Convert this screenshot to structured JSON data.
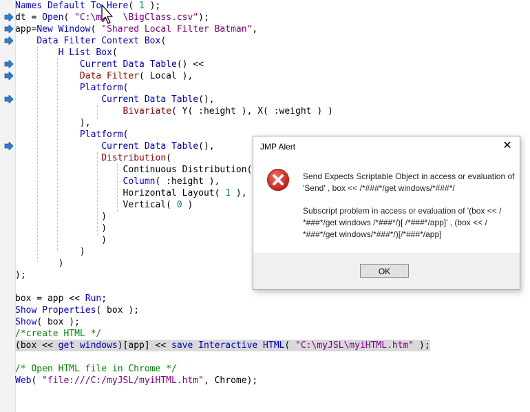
{
  "editor": {
    "lines": [
      [
        [
          "fn",
          "Names Default To Here"
        ],
        [
          "tx",
          "( "
        ],
        [
          "num",
          "1"
        ],
        [
          "tx",
          " );"
        ]
      ],
      [
        [
          "tx",
          "dt = "
        ],
        [
          "fn",
          "Open"
        ],
        [
          "tx",
          "( "
        ],
        [
          "str",
          "\"C:\\my   \\BigClass.csv\""
        ],
        [
          "tx",
          ");"
        ]
      ],
      [
        [
          "tx",
          "app="
        ],
        [
          "fn",
          "New Window"
        ],
        [
          "tx",
          "( "
        ],
        [
          "str",
          "\"Shared Local Filter Batman\""
        ],
        [
          "tx",
          ","
        ]
      ],
      [
        [
          "tx",
          "    "
        ],
        [
          "fn",
          "Data Filter Context Box"
        ],
        [
          "tx",
          "("
        ]
      ],
      [
        [
          "tx",
          "        "
        ],
        [
          "fn",
          "H List Box"
        ],
        [
          "tx",
          "("
        ]
      ],
      [
        [
          "tx",
          "            "
        ],
        [
          "fn",
          "Current Data Table"
        ],
        [
          "tx",
          "() <<"
        ]
      ],
      [
        [
          "tx",
          "            "
        ],
        [
          "bv",
          "Data Filter"
        ],
        [
          "tx",
          "( Local ),"
        ]
      ],
      [
        [
          "tx",
          "            "
        ],
        [
          "fn",
          "Platform"
        ],
        [
          "tx",
          "("
        ]
      ],
      [
        [
          "tx",
          "                "
        ],
        [
          "fn",
          "Current Data Table"
        ],
        [
          "tx",
          "(),"
        ]
      ],
      [
        [
          "tx",
          "                    "
        ],
        [
          "bv",
          "Bivariate"
        ],
        [
          "tx",
          "( Y( :height ), X( :weight ) )"
        ]
      ],
      [
        [
          "tx",
          "            ),"
        ]
      ],
      [
        [
          "tx",
          "            "
        ],
        [
          "fn",
          "Platform"
        ],
        [
          "tx",
          "("
        ]
      ],
      [
        [
          "tx",
          "                "
        ],
        [
          "fn",
          "Current Data Table"
        ],
        [
          "tx",
          "(),"
        ]
      ],
      [
        [
          "tx",
          "                "
        ],
        [
          "bv",
          "Distribution"
        ],
        [
          "tx",
          "("
        ]
      ],
      [
        [
          "tx",
          "                    "
        ],
        [
          "tx",
          "Continuous Distribution("
        ]
      ],
      [
        [
          "tx",
          "                    "
        ],
        [
          "fn",
          "Column"
        ],
        [
          "tx",
          "( :height ),"
        ]
      ],
      [
        [
          "tx",
          "                    "
        ],
        [
          "tx",
          "Horizontal Layout( "
        ],
        [
          "num",
          "1"
        ],
        [
          "tx",
          " ),"
        ]
      ],
      [
        [
          "tx",
          "                    "
        ],
        [
          "tx",
          "Vertical( "
        ],
        [
          "num",
          "0"
        ],
        [
          "tx",
          " )"
        ]
      ],
      [
        [
          "tx",
          "                )"
        ]
      ],
      [
        [
          "tx",
          "                )"
        ]
      ],
      [
        [
          "tx",
          "                )"
        ]
      ],
      [
        [
          "tx",
          "            )"
        ]
      ],
      [
        [
          "tx",
          "        )"
        ]
      ],
      [
        [
          "tx",
          ");"
        ]
      ],
      [
        [
          "tx",
          ""
        ]
      ],
      [
        [
          "tx",
          "box = app << "
        ],
        [
          "fn",
          "Run"
        ],
        [
          "tx",
          ";"
        ]
      ],
      [
        [
          "fn",
          "Show Properties"
        ],
        [
          "tx",
          "( box );"
        ]
      ],
      [
        [
          "fn",
          "Show"
        ],
        [
          "tx",
          "( box );"
        ]
      ],
      [
        [
          "cm",
          "/*create HTML */"
        ]
      ],
      [
        [
          "tx",
          "(box << "
        ],
        [
          "fn",
          "get windows"
        ],
        [
          "tx",
          ")[app] << "
        ],
        [
          "fn",
          "save Interactive HTML"
        ],
        [
          "tx",
          "( "
        ],
        [
          "str",
          "\"C:\\myJSL\\myiHTML.htm\""
        ],
        [
          "tx",
          " );"
        ]
      ],
      [
        [
          "tx",
          ""
        ]
      ],
      [
        [
          "cm",
          "/* Open HTML file in Chrome */"
        ]
      ],
      [
        [
          "fn",
          "Web"
        ],
        [
          "tx",
          "( "
        ],
        [
          "str",
          "\"file:///C:/myJSL/myiHTML.htm\""
        ],
        [
          "tx",
          ", Chrome);"
        ]
      ]
    ],
    "breakpoint_lines": [
      1,
      2,
      3,
      5,
      6,
      8,
      12
    ]
  },
  "dialog": {
    "title": "JMP Alert",
    "close_glyph": "✕",
    "message_line1": "Send Expects Scriptable Object in access or evaluation of",
    "message_line2": "'Send' , box <<  /*###*/get windows/*###*/",
    "message_line3": "Subscript problem in access or evaluation of '(box <<  /",
    "message_line4": "*###*/get windows /*###*/)[ /*###*/app]' , (box <<  /",
    "message_line5": "*###*/get windows/*###*/)[/*###*/app]",
    "ok_label": "OK",
    "icon": "error-icon"
  },
  "colors": {
    "function": "#0000c0",
    "string": "#800080",
    "number": "#008080",
    "comment": "#008000",
    "platform": "#8b0000",
    "highlight": "#d9d9d9",
    "error": "#d32f2f"
  }
}
